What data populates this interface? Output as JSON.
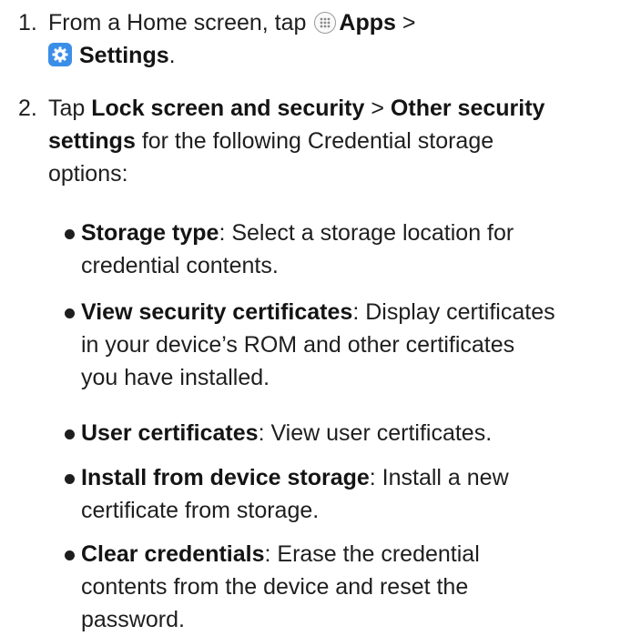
{
  "steps": [
    {
      "number": "1.",
      "prefix": "From a Home screen, tap",
      "apps_label": "Apps",
      "sep": ">",
      "settings_label": "Settings",
      "suffix": "."
    },
    {
      "number": "2.",
      "prefix": "Tap",
      "bold1": "Lock screen and security",
      "sep": ">",
      "bold2_line1": "Other security",
      "bold2_line2": "settings",
      "rest_line2": "for the following Credential storage",
      "rest_line3": "options:"
    }
  ],
  "bullets": [
    {
      "term": "Storage type",
      "line1": ": Select a storage location for",
      "line2": "credential contents."
    },
    {
      "term": "View security certificates",
      "line1": ": Display certificates",
      "line2": "in your device’s ROM and other certificates",
      "line3": "you have installed."
    },
    {
      "term": "User certificates",
      "line1": ": View user certificates."
    },
    {
      "term": "Install from device storage",
      "line1": ": Install a new",
      "line2": "certificate from storage."
    },
    {
      "term": "Clear credentials",
      "line1": ": Erase the credential",
      "line2": "contents from the device and reset the",
      "line3": "password."
    }
  ],
  "icons": {
    "apps": "apps-grid-icon",
    "settings": "settings-gear-icon",
    "settings_color": "#3b8ee8"
  }
}
